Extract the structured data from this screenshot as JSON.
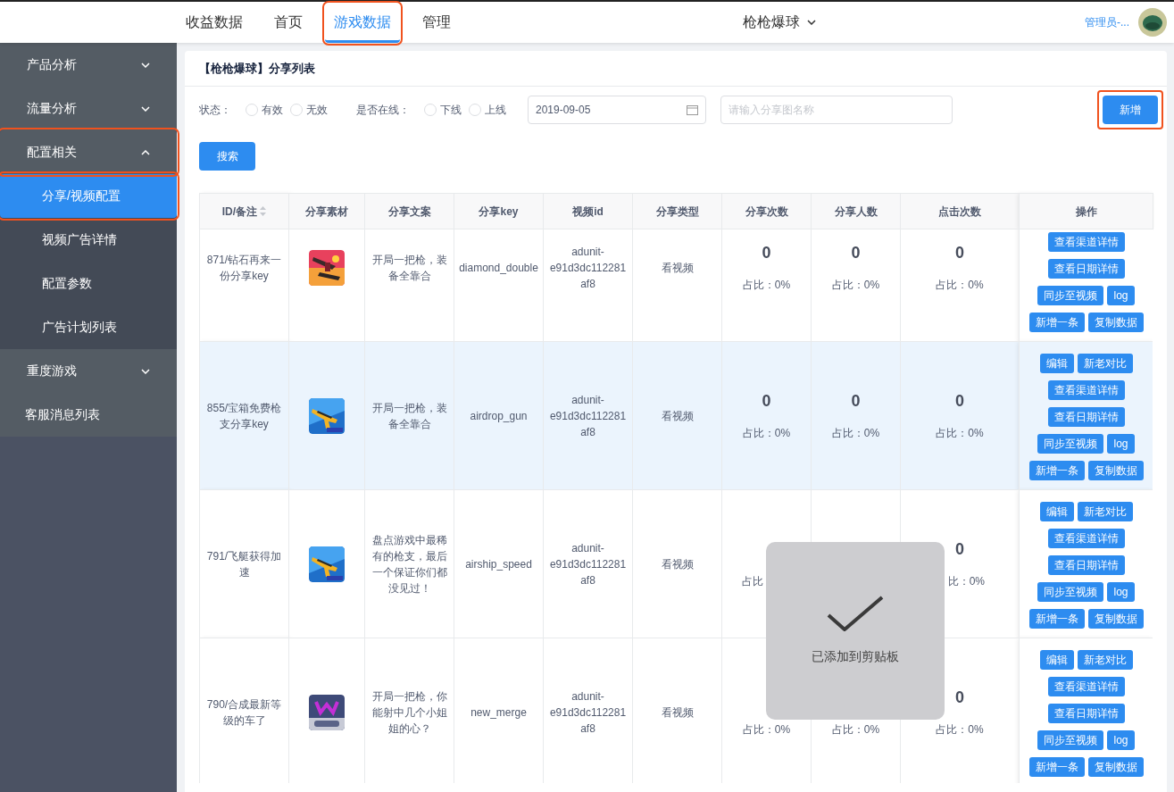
{
  "top_nav": {
    "tabs": [
      {
        "label": "收益数据",
        "selected": false,
        "annotated": false
      },
      {
        "label": "首页",
        "selected": false,
        "annotated": false
      },
      {
        "label": "游戏数据",
        "selected": true,
        "annotated": true
      },
      {
        "label": "管理",
        "selected": false,
        "annotated": false
      }
    ],
    "game_selector": "枪枪爆球",
    "user": "管理员-..."
  },
  "sidebar": {
    "items": [
      {
        "label": "产品分析",
        "kind": "group",
        "expanded": false,
        "annotated": false
      },
      {
        "label": "流量分析",
        "kind": "group",
        "expanded": false,
        "annotated": false
      },
      {
        "label": "配置相关",
        "kind": "group",
        "expanded": true,
        "annotated": true,
        "children": [
          {
            "label": "分享/视频配置",
            "selected": true,
            "annotated": true
          },
          {
            "label": "视频广告详情",
            "selected": false,
            "annotated": false
          },
          {
            "label": "配置参数",
            "selected": false,
            "annotated": false
          },
          {
            "label": "广告计划列表",
            "selected": false,
            "annotated": false
          }
        ]
      },
      {
        "label": "重度游戏",
        "kind": "group",
        "expanded": false,
        "annotated": false
      },
      {
        "label": "客服消息列表",
        "kind": "link",
        "annotated": false
      }
    ]
  },
  "card": {
    "title": "【枪枪爆球】分享列表",
    "filters": {
      "status_label": "状态：",
      "status_options": [
        {
          "label": "有效",
          "selected": false
        },
        {
          "label": "无效",
          "selected": false
        }
      ],
      "online_label": "是否在线：",
      "online_options": [
        {
          "label": "下线",
          "selected": false
        },
        {
          "label": "上线",
          "selected": false
        }
      ],
      "date": "2019-09-05",
      "search": {
        "placeholder": "请输入分享图名称"
      },
      "search_button": "搜索",
      "add_button": {
        "label": "新增",
        "annotated": true
      }
    },
    "table": {
      "columns": [
        "ID/备注",
        "分享素材",
        "分享文案",
        "分享key",
        "视频id",
        "分享类型",
        "分享次数",
        "分享人数",
        "点击次数",
        "操作"
      ],
      "rows": [
        {
          "id_note": "871/钻石再来一份分享key",
          "share_text": "开局一把枪，装备全靠合",
          "share_key": "diamond_double",
          "video_id": "adunit-e91d3dc112281af8",
          "share_type": "看视频",
          "share_count": {
            "count": "0",
            "ratio": "占比：0%"
          },
          "share_users": {
            "count": "0",
            "ratio": "占比：0%"
          },
          "clicks": {
            "count": "0",
            "ratio": "占比：0%"
          },
          "highlighted": false,
          "actions": [
            "查看渠道详情",
            "查看日期详情",
            "同步至视频",
            "log",
            "新增一条",
            "复制数据"
          ]
        },
        {
          "id_note": "855/宝箱免费枪支分享key",
          "share_text": "开局一把枪，装备全靠合",
          "share_key": "airdrop_gun",
          "video_id": "adunit-e91d3dc112281af8",
          "share_type": "看视频",
          "share_count": {
            "count": "0",
            "ratio": "占比：0%"
          },
          "share_users": {
            "count": "0",
            "ratio": "占比：0%"
          },
          "clicks": {
            "count": "0",
            "ratio": "占比：0%"
          },
          "highlighted": true,
          "actions": [
            "编辑",
            "新老对比",
            "查看渠道详情",
            "查看日期详情",
            "同步至视频",
            "log",
            "新增一条",
            "复制数据"
          ]
        },
        {
          "id_note": "791/飞艇获得加速",
          "share_text": "盘点游戏中最稀有的枪支，最后一个保证你们都没见过！",
          "share_key": "airship_speed",
          "video_id": "adunit-e91d3dc112281af8",
          "share_type": "看视频",
          "share_count": {
            "ratio": "占比",
            "cut_right": true
          },
          "clicks": {
            "count": "0",
            "ratio": "比：0%",
            "cut_left": true
          },
          "highlighted": false,
          "actions": [
            "编辑",
            "新老对比",
            "查看渠道详情",
            "查看日期详情",
            "同步至视频",
            "log",
            "新增一条",
            "复制数据"
          ]
        },
        {
          "id_note": "790/合成最新等级的车了",
          "share_text": "开局一把枪，你能射中几个小姐姐的心？",
          "share_key": "new_merge",
          "video_id": "adunit-e91d3dc112281af8",
          "share_type": "看视频",
          "share_count": {
            "ratio": "占比：0%"
          },
          "share_users": {
            "ratio": "占比：0%"
          },
          "clicks": {
            "count": "0",
            "ratio": "占比：0%"
          },
          "highlighted": false,
          "actions": [
            "编辑",
            "新老对比",
            "查看渠道详情",
            "查看日期详情",
            "同步至视频",
            "log",
            "新增一条",
            "复制数据"
          ]
        }
      ]
    }
  },
  "toast": {
    "message": "已添加到剪贴板"
  }
}
